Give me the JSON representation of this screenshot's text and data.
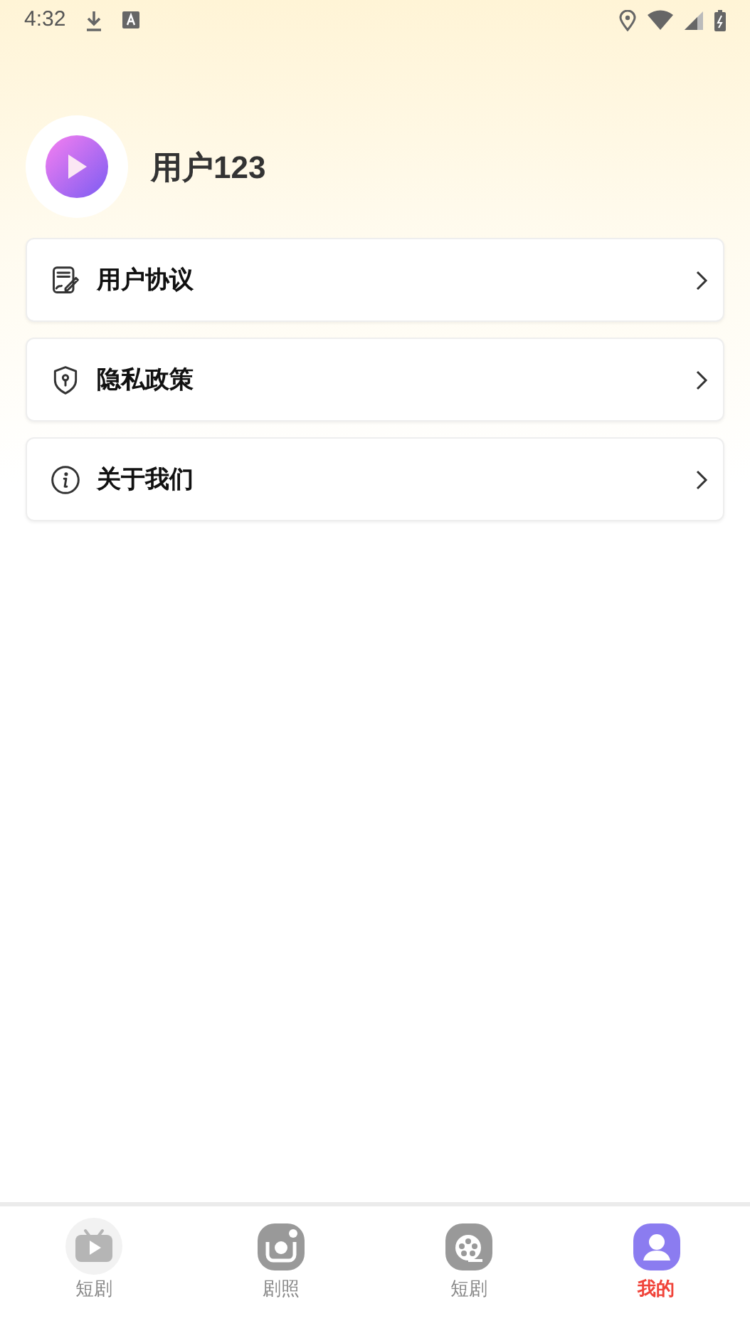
{
  "status_bar": {
    "time": "4:32"
  },
  "profile": {
    "username": "用户123"
  },
  "menu": [
    {
      "kind": "agreement",
      "label": "用户协议"
    },
    {
      "kind": "privacy",
      "label": "隐私政策"
    },
    {
      "kind": "about",
      "label": "关于我们"
    }
  ],
  "tab_bar": [
    {
      "kind": "tv",
      "label": "短剧",
      "selected": false
    },
    {
      "kind": "camera",
      "label": "剧照",
      "selected": false
    },
    {
      "kind": "film",
      "label": "短剧",
      "selected": false
    },
    {
      "kind": "person",
      "label": "我的",
      "selected": true
    }
  ]
}
